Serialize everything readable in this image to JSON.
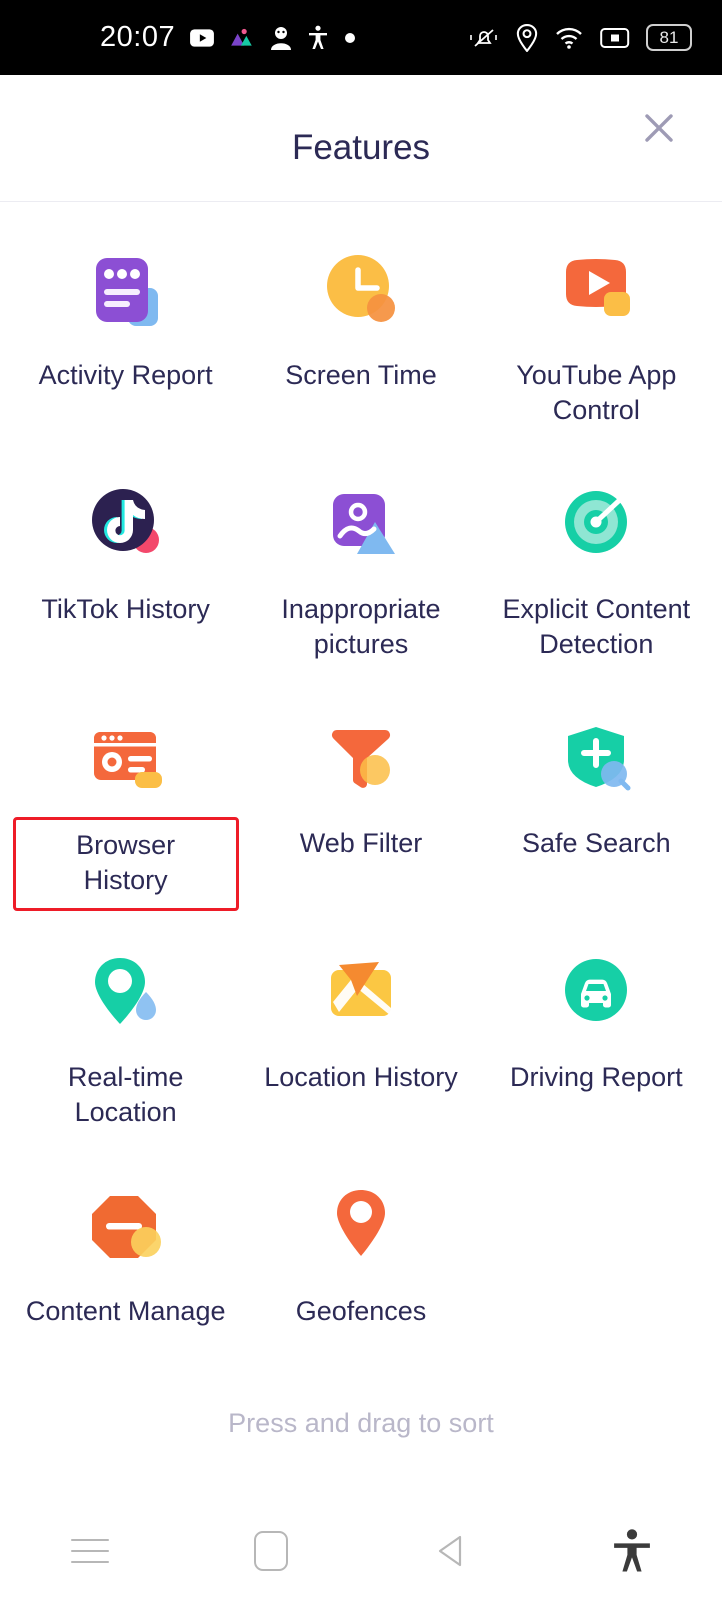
{
  "status_bar": {
    "time": "20:07",
    "left_icons": [
      "youtube-icon",
      "app-multicolor-icon",
      "contact-avatar-icon",
      "accessibility-icon",
      "dot-icon"
    ],
    "right_icons": [
      "ringer-silent-icon",
      "location-icon",
      "wifi-icon",
      "screen-record-icon"
    ],
    "battery_level": "81"
  },
  "header": {
    "title": "Features",
    "close_label": "close-icon"
  },
  "features": [
    {
      "label": "Activity Report",
      "icon": "activity-report-icon"
    },
    {
      "label": "Screen Time",
      "icon": "screen-time-icon"
    },
    {
      "label": "YouTube App Control",
      "icon": "youtube-app-control-icon"
    },
    {
      "label": "TikTok History",
      "icon": "tiktok-history-icon"
    },
    {
      "label": "Inappropriate pictures",
      "icon": "inappropriate-pictures-icon"
    },
    {
      "label": "Explicit Content Detection",
      "icon": "explicit-content-detection-icon"
    },
    {
      "label": "Browser History",
      "icon": "browser-history-icon",
      "highlighted": true
    },
    {
      "label": "Web Filter",
      "icon": "web-filter-icon"
    },
    {
      "label": "Safe Search",
      "icon": "safe-search-icon"
    },
    {
      "label": "Real-time Location",
      "icon": "real-time-location-icon"
    },
    {
      "label": "Location History",
      "icon": "location-history-icon"
    },
    {
      "label": "Driving Report",
      "icon": "driving-report-icon"
    },
    {
      "label": "Content Manage",
      "icon": "content-manage-icon"
    },
    {
      "label": "Geofences",
      "icon": "geofences-icon"
    }
  ],
  "footer": {
    "sort_hint": "Press and drag to sort"
  },
  "navbar": {
    "items": [
      {
        "name": "recents-button",
        "icon": "hamburger-icon"
      },
      {
        "name": "home-button",
        "icon": "square-icon"
      },
      {
        "name": "back-button",
        "icon": "triangle-left-icon"
      },
      {
        "name": "accessibility-button",
        "icon": "accessibility-person-icon"
      }
    ]
  },
  "colors": {
    "text_primary": "#2c2a55",
    "hint": "#b9b7c9",
    "highlight_box": "#ee1c28",
    "purple": "#8c4fd4",
    "orange": "#f4683c",
    "yellow": "#fbbe46",
    "teal": "#16cfa6",
    "blue": "#7fb9f0",
    "status_bg": "#000000"
  }
}
